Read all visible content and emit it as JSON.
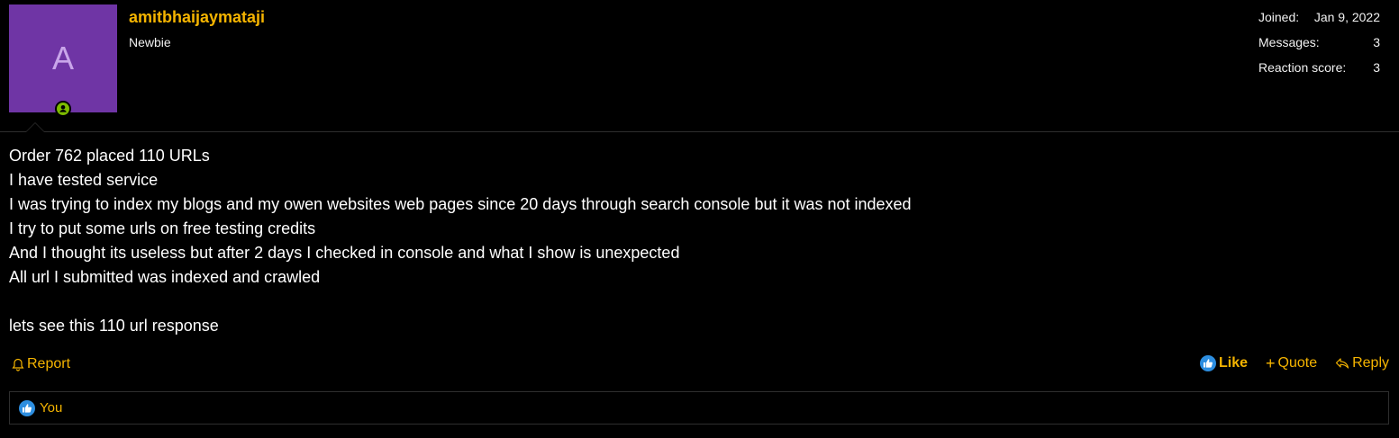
{
  "user": {
    "avatar_letter": "A",
    "avatar_color": "#6f35a5",
    "name": "amitbhaijaymataji",
    "title": "Newbie",
    "online_icon": "user-online-icon"
  },
  "stats": [
    {
      "label": "Joined:",
      "value": "Jan 9, 2022"
    },
    {
      "label": "Messages:",
      "value": "3"
    },
    {
      "label": "Reaction score:",
      "value": "3"
    }
  ],
  "message": {
    "lines": [
      "Order 762 placed 110 URLs",
      "I have tested service",
      "I was trying to index my blogs and my owen websites web pages since 20 days through search console but it was not indexed",
      "I try to put some urls on free testing credits",
      "And I thought its useless but after 2 days I checked in console and what I show is unexpected",
      "All url I submitted was indexed and crawled",
      "",
      "lets see this 110 url response"
    ]
  },
  "actions": {
    "report": "Report",
    "like": "Like",
    "quote": "Quote",
    "reply": "Reply"
  },
  "reactions": {
    "icon": "like-icon",
    "text": "You"
  },
  "colors": {
    "accent": "#f5b400",
    "background": "#000000",
    "like_blue": "#2d8ee0",
    "online_green": "#7dbb00"
  }
}
